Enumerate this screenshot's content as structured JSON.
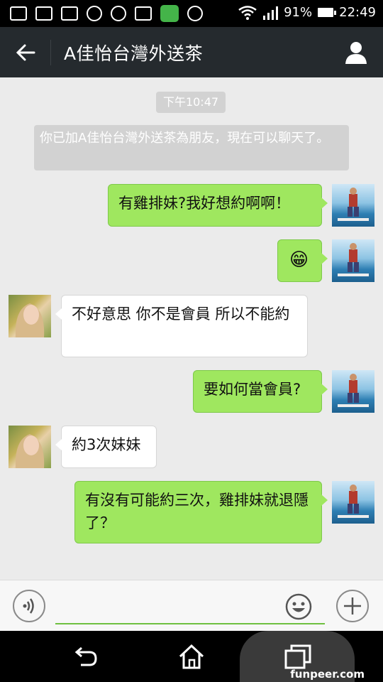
{
  "status_bar": {
    "battery": "91%",
    "time": "22:49",
    "icons": [
      "notification-icon",
      "gallery-icon",
      "gmail-icon",
      "podcast-icon",
      "podcast-icon",
      "mail-icon",
      "line-app-icon",
      "alarm-icon",
      "wifi-icon",
      "signal-icon",
      "battery-icon"
    ]
  },
  "header": {
    "title": "A佳怡台灣外送茶",
    "back_icon": "arrow-left-icon",
    "contact_icon": "person-icon"
  },
  "chat": {
    "time_label": "下午10:47",
    "system_message": "你已加A佳怡台灣外送茶為朋友，現在可以聊天了。",
    "messages": [
      {
        "from": "me",
        "text": "有雞排妹?我好想約啊啊！"
      },
      {
        "from": "me",
        "text": "😁",
        "type": "emoji"
      },
      {
        "from": "her",
        "text": "不好意思 你不是會員 所以不能約"
      },
      {
        "from": "me",
        "text": "要如何當會員?"
      },
      {
        "from": "her",
        "text": "約3次妹妹"
      },
      {
        "from": "me",
        "text": "有沒有可能約三次，雞排妹就退隱了？"
      }
    ]
  },
  "input_bar": {
    "voice_icon": "voice-icon",
    "emoji_icon": "smiley-icon",
    "plus_icon": "plus-icon",
    "input_value": ""
  },
  "nav_bar": {
    "icons": [
      "back-icon",
      "home-icon",
      "recent-apps-icon"
    ],
    "watermark": "funpeer.com"
  },
  "colors": {
    "header_bg": "#252a2e",
    "chat_bg": "#ebebeb",
    "my_bubble": "#9fe75f",
    "her_bubble": "#ffffff",
    "accent_line": "#6fc040"
  }
}
